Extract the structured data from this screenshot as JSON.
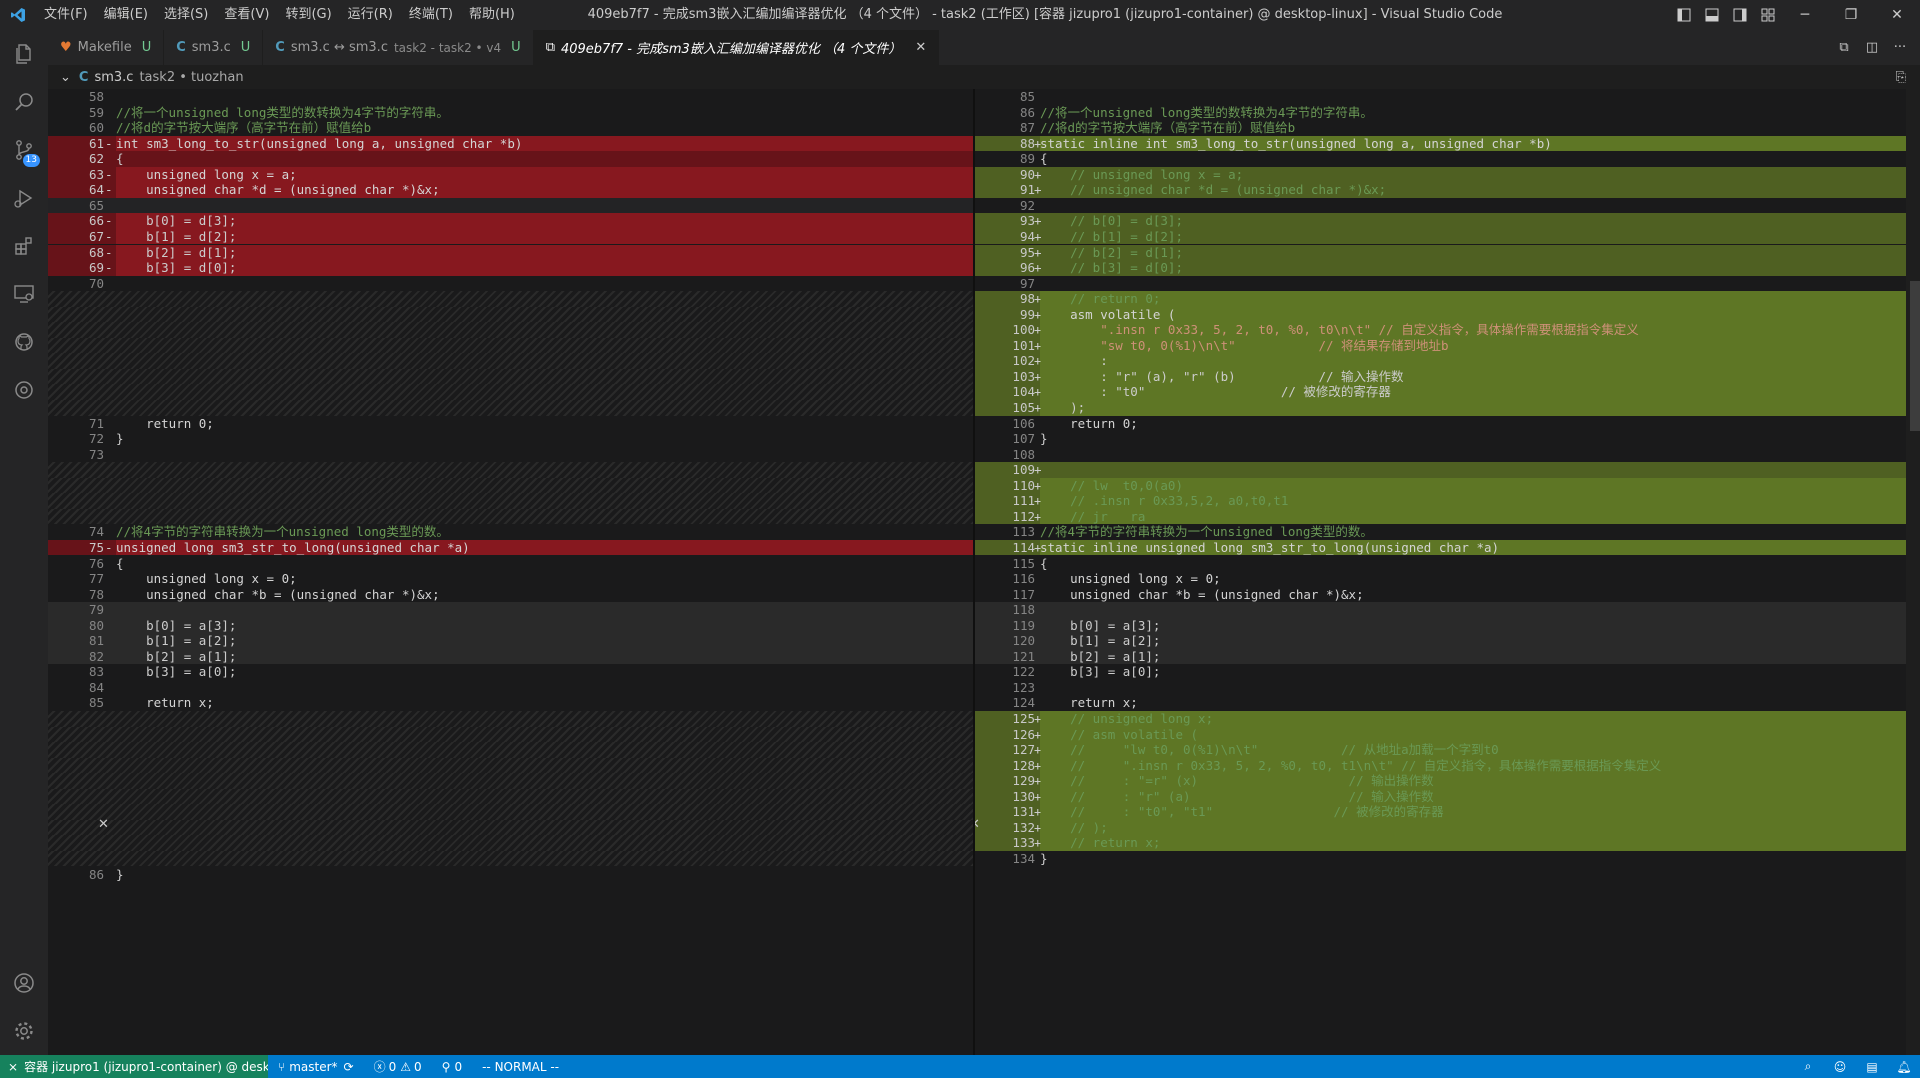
{
  "app": {
    "logo": "vscode-icon",
    "menus": [
      "文件(F)",
      "编辑(E)",
      "选择(S)",
      "查看(V)",
      "转到(G)",
      "运行(R)",
      "终端(T)",
      "帮助(H)"
    ],
    "title": "409eb7f7 - 完成sm3嵌入汇编加编译器优化 （4 个文件） - task2 (工作区) [容器 jizupro1 (jizupro1-container) @ desktop-linux] - Visual Studio Code"
  },
  "activity_bar": {
    "icons": [
      "explorer-icon",
      "search-icon",
      "source-control-icon",
      "run-debug-icon",
      "extensions-icon",
      "remote-explorer-icon",
      "github-icon",
      "timeline-icon"
    ],
    "badge": "13",
    "bottom_icons": [
      "account-icon",
      "settings-gear-icon"
    ]
  },
  "tabs": [
    {
      "label": "Makefile",
      "status": "U",
      "icon": "makefile-icon",
      "active": false
    },
    {
      "label": "sm3.c",
      "status": "U",
      "icon": "c-file-icon",
      "active": false
    },
    {
      "label": "sm3.c ↔ sm3.c",
      "sub": "task2 - task2 • v4",
      "status": "U",
      "icon": "c-file-icon",
      "active": false
    },
    {
      "label": "409eb7f7 - 完成sm3嵌入汇编加编译器优化 （4 个文件）",
      "icon": "multi-diff-icon",
      "active": true
    }
  ],
  "breadcrumb": {
    "file": "sm3.c",
    "path": "task2 • tuozhan"
  },
  "diff": {
    "left": [
      {
        "n": "58",
        "code": ""
      },
      {
        "n": "59",
        "code": "//将一个unsigned long类型的数转换为4字节的字符串。"
      },
      {
        "n": "60",
        "code": "//将d的字节按大端序（高字节在前）赋值给b"
      },
      {
        "n": "61",
        "sign": "-",
        "code": "int sm3_long_to_str(unsigned long a, unsigned char *b)",
        "cls": "del delc"
      },
      {
        "n": "62",
        "code": "{",
        "cls": "del"
      },
      {
        "n": "63",
        "sign": "-",
        "code": "    unsigned long x = a;",
        "cls": "del delc"
      },
      {
        "n": "64",
        "sign": "-",
        "code": "    unsigned char *d = (unsigned char *)&x;",
        "cls": "del delc"
      },
      {
        "n": "65",
        "code": "",
        "cls": "dark"
      },
      {
        "n": "66",
        "sign": "-",
        "code": "    b[0] = d[3];",
        "cls": "del delc"
      },
      {
        "n": "67",
        "sign": "-",
        "code": "    b[1] = d[2];",
        "cls": "del delc"
      },
      {
        "n": "68",
        "sign": "-",
        "code": "    b[2] = d[1];",
        "cls": "del delc"
      },
      {
        "n": "69",
        "sign": "-",
        "code": "    b[3] = d[0];",
        "cls": "del delc"
      },
      {
        "n": "70",
        "code": ""
      },
      {
        "n": "",
        "code": "",
        "cls": "fill"
      },
      {
        "n": "",
        "code": "",
        "cls": "fill"
      },
      {
        "n": "",
        "code": "",
        "cls": "fill"
      },
      {
        "n": "",
        "code": "",
        "cls": "fill"
      },
      {
        "n": "",
        "code": "",
        "cls": "fill"
      },
      {
        "n": "",
        "code": "",
        "cls": "fill"
      },
      {
        "n": "",
        "code": "",
        "cls": "fill"
      },
      {
        "n": "",
        "code": "",
        "cls": "fill"
      },
      {
        "n": "71",
        "code": "    return 0;"
      },
      {
        "n": "72",
        "code": "}"
      },
      {
        "n": "73",
        "code": ""
      },
      {
        "n": "",
        "code": "",
        "cls": "fill"
      },
      {
        "n": "",
        "code": "",
        "cls": "fill"
      },
      {
        "n": "",
        "code": "",
        "cls": "fill"
      },
      {
        "n": "",
        "code": "",
        "cls": "fill"
      },
      {
        "n": "74",
        "code": "//将4字节的字符串转换为一个unsigned long类型的数。"
      },
      {
        "n": "75",
        "sign": "-",
        "code": "unsigned long sm3_str_to_long(unsigned char *a)",
        "cls": "del delc"
      },
      {
        "n": "76",
        "code": "{"
      },
      {
        "n": "77",
        "code": "    unsigned long x = 0;"
      },
      {
        "n": "78",
        "code": "    unsigned char *b = (unsigned char *)&x;"
      },
      {
        "n": "79",
        "code": "",
        "cls": "gray"
      },
      {
        "n": "80",
        "code": "    b[0] = a[3];",
        "cls": "gray"
      },
      {
        "n": "81",
        "code": "    b[1] = a[2];",
        "cls": "gray"
      },
      {
        "n": "82",
        "code": "    b[2] = a[1];",
        "cls": "gray"
      },
      {
        "n": "83",
        "code": "    b[3] = a[0];"
      },
      {
        "n": "84",
        "code": ""
      },
      {
        "n": "85",
        "code": "    return x;"
      },
      {
        "n": "",
        "code": "",
        "cls": "fill"
      },
      {
        "n": "",
        "code": "",
        "cls": "fill"
      },
      {
        "n": "",
        "code": "",
        "cls": "fill"
      },
      {
        "n": "",
        "code": "",
        "cls": "fill"
      },
      {
        "n": "",
        "code": "",
        "cls": "fill"
      },
      {
        "n": "",
        "code": "",
        "cls": "fill"
      },
      {
        "n": "",
        "code": "",
        "cls": "fill"
      },
      {
        "n": "",
        "code": "",
        "cls": "fill"
      },
      {
        "n": "",
        "code": "",
        "cls": "fill"
      },
      {
        "n": "",
        "code": "",
        "cls": "fill"
      },
      {
        "n": "86",
        "code": "}"
      }
    ],
    "right": [
      {
        "n": "85",
        "code": ""
      },
      {
        "n": "86",
        "code": "//将一个unsigned long类型的数转换为4字节的字符串。"
      },
      {
        "n": "87",
        "code": "//将d的字节按大端序（高字节在前）赋值给b"
      },
      {
        "n": "88",
        "sign": "+",
        "code": "static inline int sm3_long_to_str(unsigned long a, unsigned char *b)",
        "cls": "ins insc"
      },
      {
        "n": "89",
        "code": "{"
      },
      {
        "n": "90",
        "sign": "+",
        "code": "    // unsigned long x = a;",
        "cls": "ins"
      },
      {
        "n": "91",
        "sign": "+",
        "code": "    // unsigned char *d = (unsigned char *)&x;",
        "cls": "ins"
      },
      {
        "n": "92",
        "code": ""
      },
      {
        "n": "93",
        "sign": "+",
        "code": "    // b[0] = d[3];",
        "cls": "ins"
      },
      {
        "n": "94",
        "sign": "+",
        "code": "    // b[1] = d[2];",
        "cls": "ins"
      },
      {
        "n": "95",
        "sign": "+",
        "code": "    // b[2] = d[1];",
        "cls": "ins"
      },
      {
        "n": "96",
        "sign": "+",
        "code": "    // b[3] = d[0];",
        "cls": "ins"
      },
      {
        "n": "97",
        "code": ""
      },
      {
        "n": "98",
        "sign": "+",
        "code": "    // return 0;",
        "cls": "ins insc"
      },
      {
        "n": "99",
        "sign": "+",
        "code": "    asm volatile (",
        "cls": "ins insc"
      },
      {
        "n": "100",
        "sign": "+",
        "code": "        \".insn r 0x33, 5, 2, t0, %0, t0\\n\\t\" // 自定义指令，具体操作需要根据指令集定义",
        "cls": "ins insc"
      },
      {
        "n": "101",
        "sign": "+",
        "code": "        \"sw t0, 0(%1)\\n\\t\"           // 将结果存储到地址b",
        "cls": "ins insc"
      },
      {
        "n": "102",
        "sign": "+",
        "code": "        :",
        "cls": "ins insc"
      },
      {
        "n": "103",
        "sign": "+",
        "code": "        : \"r\" (a), \"r\" (b)           // 输入操作数",
        "cls": "ins insc"
      },
      {
        "n": "104",
        "sign": "+",
        "code": "        : \"t0\"                  // 被修改的寄存器",
        "cls": "ins insc"
      },
      {
        "n": "105",
        "sign": "+",
        "code": "    );",
        "cls": "ins insc"
      },
      {
        "n": "106",
        "code": "    return 0;"
      },
      {
        "n": "107",
        "code": "}"
      },
      {
        "n": "108",
        "code": ""
      },
      {
        "n": "109",
        "sign": "+",
        "code": "",
        "cls": "ins insc"
      },
      {
        "n": "110",
        "sign": "+",
        "code": "    // lw  t0,0(a0)",
        "cls": "ins insc"
      },
      {
        "n": "111",
        "sign": "+",
        "code": "    // .insn r 0x33,5,2, a0,t0,t1",
        "cls": "ins insc"
      },
      {
        "n": "112",
        "sign": "+",
        "code": "    // jr   ra",
        "cls": "ins insc"
      },
      {
        "n": "113",
        "code": "//将4字节的字符串转换为一个unsigned long类型的数。"
      },
      {
        "n": "114",
        "sign": "+",
        "code": "static inline unsigned long sm3_str_to_long(unsigned char *a)",
        "cls": "ins insc"
      },
      {
        "n": "115",
        "code": "{"
      },
      {
        "n": "116",
        "code": "    unsigned long x = 0;"
      },
      {
        "n": "117",
        "code": "    unsigned char *b = (unsigned char *)&x;"
      },
      {
        "n": "118",
        "code": "",
        "cls": "gray"
      },
      {
        "n": "119",
        "code": "    b[0] = a[3];",
        "cls": "gray"
      },
      {
        "n": "120",
        "code": "    b[1] = a[2];",
        "cls": "gray"
      },
      {
        "n": "121",
        "code": "    b[2] = a[1];",
        "cls": "gray"
      },
      {
        "n": "122",
        "code": "    b[3] = a[0];"
      },
      {
        "n": "123",
        "code": ""
      },
      {
        "n": "124",
        "code": "    return x;"
      },
      {
        "n": "125",
        "sign": "+",
        "code": "    // unsigned long x;",
        "cls": "ins insc"
      },
      {
        "n": "126",
        "sign": "+",
        "code": "    // asm volatile (",
        "cls": "ins insc"
      },
      {
        "n": "127",
        "sign": "+",
        "code": "    //     \"lw t0, 0(%1)\\n\\t\"           // 从地址a加载一个字到t0",
        "cls": "ins insc"
      },
      {
        "n": "128",
        "sign": "+",
        "code": "    //     \".insn r 0x33, 5, 2, %0, t0, t1\\n\\t\" // 自定义指令，具体操作需要根据指令集定义",
        "cls": "ins insc"
      },
      {
        "n": "129",
        "sign": "+",
        "code": "    //     : \"=r\" (x)                    // 输出操作数",
        "cls": "ins insc"
      },
      {
        "n": "130",
        "sign": "+",
        "code": "    //     : \"r\" (a)                     // 输入操作数",
        "cls": "ins insc"
      },
      {
        "n": "131",
        "sign": "+",
        "code": "    //     : \"t0\", \"t1\"                // 被修改的寄存器",
        "cls": "ins insc"
      },
      {
        "n": "132",
        "sign": "+",
        "code": "    // );",
        "cls": "ins insc"
      },
      {
        "n": "133",
        "sign": "+",
        "code": "    // return x;",
        "cls": "ins insc"
      },
      {
        "n": "134",
        "code": "}"
      }
    ]
  },
  "statusbar": {
    "remote": "容器 jizupro1 (jizupro1-container) @ deskt...",
    "branch": "master*",
    "errors": "0",
    "warnings": "0",
    "ports": "0",
    "mode": "-- NORMAL --",
    "right_icons": [
      "zoom-icon",
      "copilot-icon",
      "layout-icon",
      "notifications-bell-icon"
    ]
  },
  "colors": {
    "statusbar": "#007acc",
    "remote": "#16825d",
    "deleted": "#7d1218",
    "inserted": "#5c7024"
  }
}
